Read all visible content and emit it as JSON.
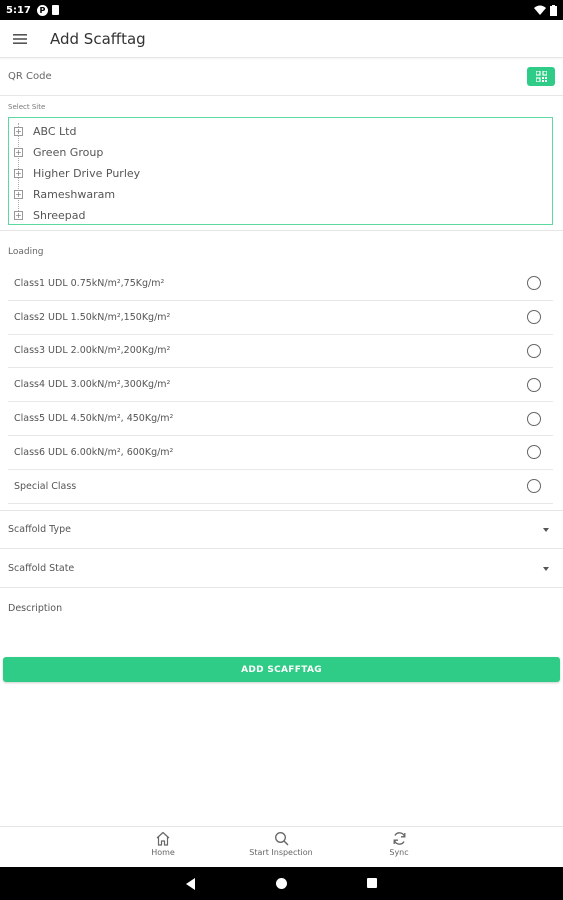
{
  "status_bar": {
    "time": "5:17"
  },
  "app_bar": {
    "title": "Add Scafftag"
  },
  "qr": {
    "label": "QR Code"
  },
  "site": {
    "label": "Select Site",
    "items": [
      {
        "label": "ABC Ltd"
      },
      {
        "label": "Green Group"
      },
      {
        "label": "Higher Drive Purley"
      },
      {
        "label": "Rameshwaram"
      },
      {
        "label": "Shreepad"
      }
    ]
  },
  "loading": {
    "label": "Loading",
    "options": [
      {
        "label": "Class1 UDL 0.75kN/m²,75Kg/m²"
      },
      {
        "label": "Class2 UDL 1.50kN/m²,150Kg/m²"
      },
      {
        "label": "Class3 UDL 2.00kN/m²,200Kg/m²"
      },
      {
        "label": "Class4 UDL 3.00kN/m²,300Kg/m²"
      },
      {
        "label": "Class5 UDL 4.50kN/m², 450Kg/m²"
      },
      {
        "label": "Class6 UDL 6.00kN/m², 600Kg/m²"
      },
      {
        "label": "Special Class"
      }
    ]
  },
  "scaffold_type": {
    "label": "Scaffold Type"
  },
  "scaffold_state": {
    "label": "Scaffold State"
  },
  "description": {
    "placeholder": "Description"
  },
  "add_button": {
    "label": "ADD SCAFFTAG"
  },
  "bottom_nav": {
    "items": [
      {
        "label": "Home",
        "icon": "home-icon"
      },
      {
        "label": "Start Inspection",
        "icon": "search-icon"
      },
      {
        "label": "Sync",
        "icon": "sync-icon"
      }
    ]
  },
  "colors": {
    "accent": "#2ecc86",
    "border_accent": "#5dd89e"
  }
}
